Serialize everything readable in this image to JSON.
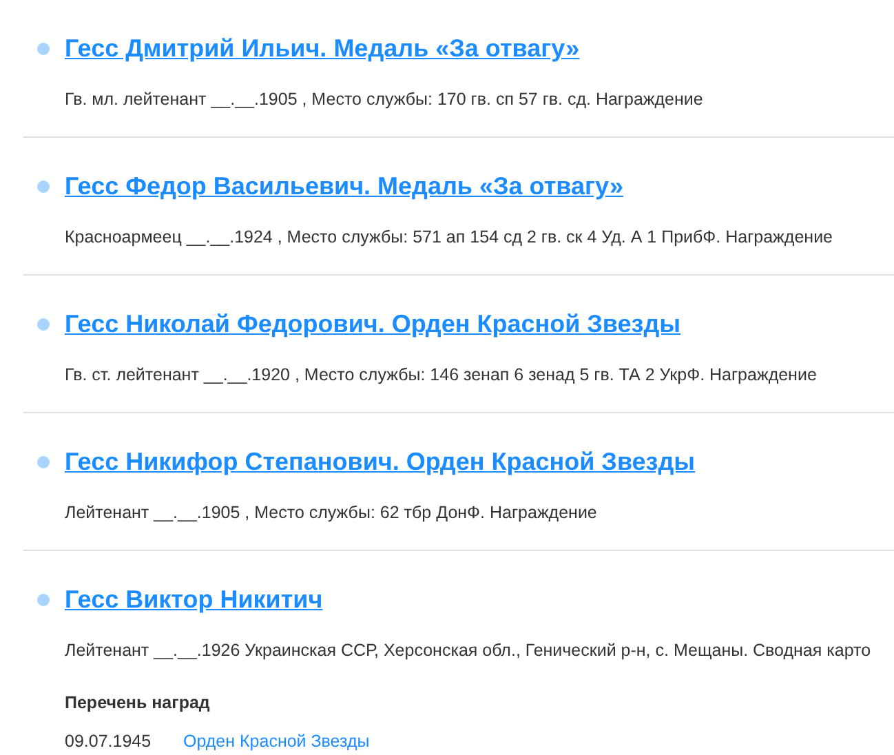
{
  "results": [
    {
      "title": "Гесс Дмитрий Ильич. Медаль «За отвагу»",
      "details": "Гв. мл. лейтенант __.__.1905 , Место службы: 170 гв. сп 57 гв. сд. Награждение"
    },
    {
      "title": "Гесс Федор Васильевич. Медаль «За отвагу»",
      "details": "Красноармеец __.__.1924 , Место службы: 571 ап 154 сд 2 гв. ск 4 Уд. А 1 ПрибФ. Награждение"
    },
    {
      "title": "Гесс Николай Федорович. Орден Красной Звезды",
      "details": "Гв. ст. лейтенант __.__.1920 , Место службы: 146 зенап 6 зенад 5 гв. ТА 2 УкрФ. Награждение"
    },
    {
      "title": "Гесс Никифор Степанович. Орден Красной Звезды",
      "details": "Лейтенант __.__.1905 , Место службы: 62 тбр ДонФ. Награждение"
    },
    {
      "title": "Гесс Виктор Никитич",
      "details": "Лейтенант __.__.1926 Украинская ССР, Херсонская обл., Генический р-н, с. Мещаны. Сводная карто",
      "awards_heading": "Перечень наград",
      "awards": [
        {
          "date": "09.07.1945",
          "name": "Орден Красной Звезды"
        }
      ]
    }
  ]
}
